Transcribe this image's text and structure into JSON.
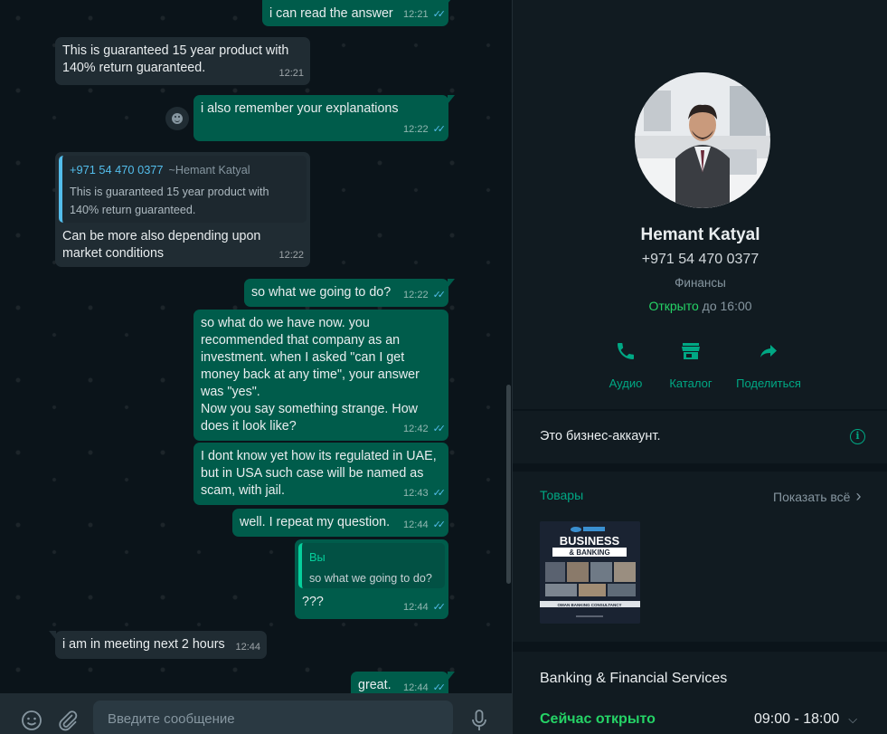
{
  "chat": {
    "messages": [
      {
        "text": "i can read the answer",
        "time": "12:21"
      },
      {
        "text": "This is guaranteed 15 year product with\n140% return guaranteed.",
        "time": "12:21"
      },
      {
        "text": "i also remember your explanations",
        "time": "12:22"
      },
      {
        "quote_author": "+971 54 470 0377",
        "quote_sub": "~Hemant Katyal",
        "quote_text": "This is guaranteed 15 year product with\n140% return guaranteed.",
        "text": "Can be more also depending upon\nmarket conditions",
        "time": "12:22"
      },
      {
        "text": "so what we going to do?",
        "time": "12:22"
      },
      {
        "text": "so what do we have now. you\nrecommended that company as an\ninvestment. when I asked \"can I get\nmoney back at any time\", your answer\nwas \"yes\".\nNow you say something strange. How\ndoes it look like?",
        "time": "12:42"
      },
      {
        "text": "I dont know yet how its regulated in UAE,\nbut in USA such case will be named as\nscam, with jail.",
        "time": "12:43"
      },
      {
        "text": "well. I repeat my question.",
        "time": "12:44"
      },
      {
        "quote_author": "Вы",
        "quote_text": "so what we going to do?",
        "text": "???",
        "time": "12:44"
      },
      {
        "text": "i am in meeting next 2 hours",
        "time": "12:44"
      },
      {
        "text": "great.",
        "time": "12:44"
      }
    ],
    "composer_placeholder": "Введите сообщение"
  },
  "profile": {
    "name": "Hemant Katyal",
    "phone": "+971 54 470 0377",
    "category": "Финансы",
    "hours_open": "Открыто",
    "hours_until": " до 16:00",
    "actions": [
      {
        "label": "Аудио",
        "icon": "phone-icon"
      },
      {
        "label": "Каталог",
        "icon": "store-icon"
      },
      {
        "label": "Поделиться",
        "icon": "share-icon"
      }
    ],
    "business_note": "Это бизнес-аккаунт.",
    "goods_label": "Товары",
    "show_all": "Показать всё",
    "product": {
      "title_top": "BUSINESS",
      "title_bottom": "& BANKING",
      "subtitle": "OMAN BANKING CONSULTANCY"
    },
    "service": "Banking & Financial Services",
    "now_open": "Сейчас открыто",
    "time_range": "09:00 - 18:00"
  },
  "colors": {
    "outgoing_bubble": "#005c4b",
    "incoming_bubble": "#202c33",
    "accent": "#00a884",
    "open_green": "#25d366",
    "read_ticks": "#53bdeb"
  }
}
